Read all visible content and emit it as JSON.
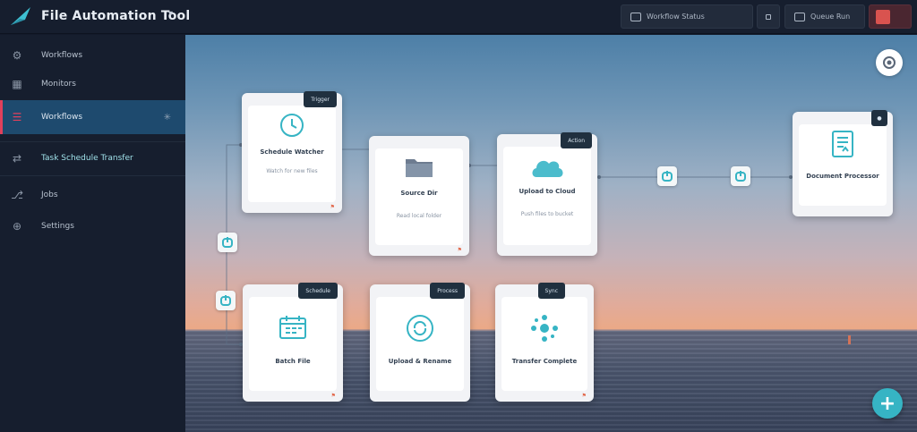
{
  "header": {
    "title": "File Automation Tool",
    "buttons": [
      {
        "label": "Workflow Status"
      },
      {
        "label": ""
      },
      {
        "label": "Queue Run"
      }
    ]
  },
  "sidebar": {
    "items": [
      {
        "label": "Workflows",
        "icon": "gear-icon"
      },
      {
        "label": "Monitors",
        "icon": "grid-icon"
      },
      {
        "label": "Workflows",
        "icon": "list-icon",
        "active": true
      },
      {
        "label": "Task Schedule Transfer",
        "icon": "transfer-icon"
      },
      {
        "label": "Jobs",
        "icon": "share-icon"
      },
      {
        "label": "Settings",
        "icon": "globe-icon"
      }
    ]
  },
  "nodes": [
    {
      "id": "n1",
      "tag": "Trigger",
      "label": "Schedule Watcher",
      "sub": "Watch for new files",
      "flag": "⚑",
      "icon": "clock-icon"
    },
    {
      "id": "n2",
      "tag": "",
      "label": "Source Dir",
      "sub": "Read local folder",
      "flag": "⚑",
      "icon": "folder-icon"
    },
    {
      "id": "n3",
      "tag": "Action",
      "label": "Upload to Cloud",
      "sub": "Push files to bucket",
      "flag": "",
      "icon": "cloud-icon"
    },
    {
      "id": "n4",
      "tag": "",
      "label": "Document Processor",
      "sub": "",
      "flag": "",
      "icon": "document-icon"
    },
    {
      "id": "n5",
      "tag": "Schedule",
      "label": "Batch File",
      "sub": "",
      "flag": "⚑",
      "icon": "calendar-icon"
    },
    {
      "id": "n6",
      "tag": "Process",
      "label": "Upload & Rename",
      "sub": "",
      "flag": "",
      "icon": "refresh-icon"
    },
    {
      "id": "n7",
      "tag": "Sync",
      "label": "Transfer Complete",
      "sub": "",
      "flag": "⚑",
      "icon": "network-icon"
    }
  ],
  "colors": {
    "accent": "#36b4c4",
    "active_bar": "#e0405c",
    "sidebar_bg": "#161e2e",
    "node_tag_bg": "#20303f"
  }
}
